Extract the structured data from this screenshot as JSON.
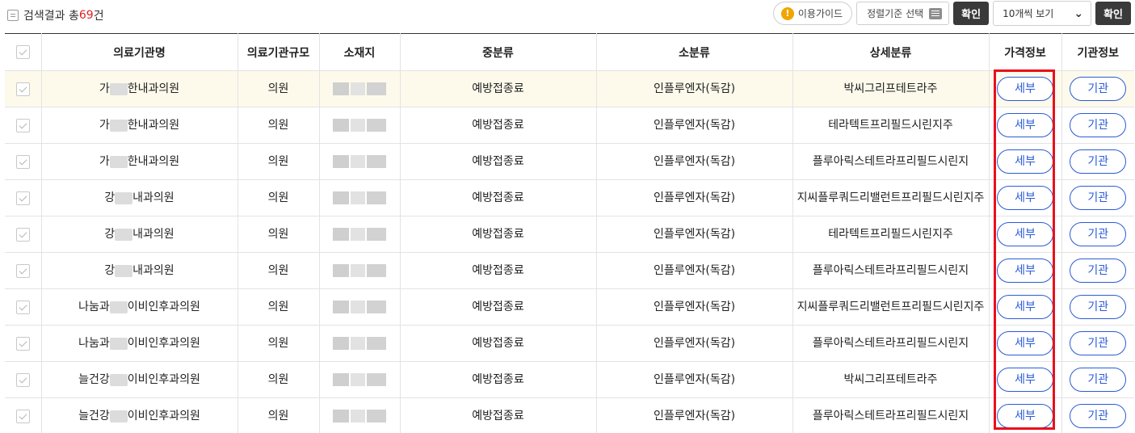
{
  "summary": {
    "prefix": "검색결과 총",
    "count": "69",
    "suffix": "건"
  },
  "controls": {
    "guide_label": "이용가이드",
    "sort_label": "정렬기준 선택",
    "confirm_label": "확인",
    "per_page_label": "10개씩 보기",
    "confirm2_label": "확인"
  },
  "table": {
    "headers": [
      "의료기관명",
      "의료기관규모",
      "소재지",
      "중분류",
      "소분류",
      "상세분류",
      "가격정보",
      "기관정보"
    ],
    "rows": [
      {
        "name_pre": "가",
        "name_post": "한내과의원",
        "size": "의원",
        "mid": "예방접종료",
        "small": "인플루엔자(독감)",
        "detail": "박씨그리프테트라주",
        "price_btn": "세부",
        "org_btn": "기관"
      },
      {
        "name_pre": "가",
        "name_post": "한내과의원",
        "size": "의원",
        "mid": "예방접종료",
        "small": "인플루엔자(독감)",
        "detail": "테라텍트프리필드시린지주",
        "price_btn": "세부",
        "org_btn": "기관"
      },
      {
        "name_pre": "가",
        "name_post": "한내과의원",
        "size": "의원",
        "mid": "예방접종료",
        "small": "인플루엔자(독감)",
        "detail": "플루아릭스테트라프리필드시린지",
        "price_btn": "세부",
        "org_btn": "기관"
      },
      {
        "name_pre": "강",
        "name_post": "내과의원",
        "size": "의원",
        "mid": "예방접종료",
        "small": "인플루엔자(독감)",
        "detail": "지씨플루쿼드리밸런트프리필드시린지주",
        "price_btn": "세부",
        "org_btn": "기관"
      },
      {
        "name_pre": "강",
        "name_post": "내과의원",
        "size": "의원",
        "mid": "예방접종료",
        "small": "인플루엔자(독감)",
        "detail": "테라텍트프리필드시린지주",
        "price_btn": "세부",
        "org_btn": "기관"
      },
      {
        "name_pre": "강",
        "name_post": "내과의원",
        "size": "의원",
        "mid": "예방접종료",
        "small": "인플루엔자(독감)",
        "detail": "플루아릭스테트라프리필드시린지",
        "price_btn": "세부",
        "org_btn": "기관"
      },
      {
        "name_pre": "나눔과",
        "name_post": "이비인후과의원",
        "size": "의원",
        "mid": "예방접종료",
        "small": "인플루엔자(독감)",
        "detail": "지씨플루쿼드리밸런트프리필드시린지주",
        "price_btn": "세부",
        "org_btn": "기관"
      },
      {
        "name_pre": "나눔과",
        "name_post": "이비인후과의원",
        "size": "의원",
        "mid": "예방접종료",
        "small": "인플루엔자(독감)",
        "detail": "플루아릭스테트라프리필드시린지",
        "price_btn": "세부",
        "org_btn": "기관"
      },
      {
        "name_pre": "늘건강",
        "name_post": "이비인후과의원",
        "size": "의원",
        "mid": "예방접종료",
        "small": "인플루엔자(독감)",
        "detail": "박씨그리프테트라주",
        "price_btn": "세부",
        "org_btn": "기관"
      },
      {
        "name_pre": "늘건강",
        "name_post": "이비인후과의원",
        "size": "의원",
        "mid": "예방접종료",
        "small": "인플루엔자(독감)",
        "detail": "플루아릭스테트라프리필드시린지",
        "price_btn": "세부",
        "org_btn": "기관"
      }
    ]
  },
  "colors": {
    "accent_blue": "#2a5bd7",
    "count_red": "#e02020",
    "highlight_box": "#e8101d",
    "row_highlight": "#fdfaec"
  },
  "icons": {
    "summary": "list-icon",
    "guide": "warning-icon",
    "sort": "menu-icon",
    "per_page": "chevron-down-icon"
  }
}
